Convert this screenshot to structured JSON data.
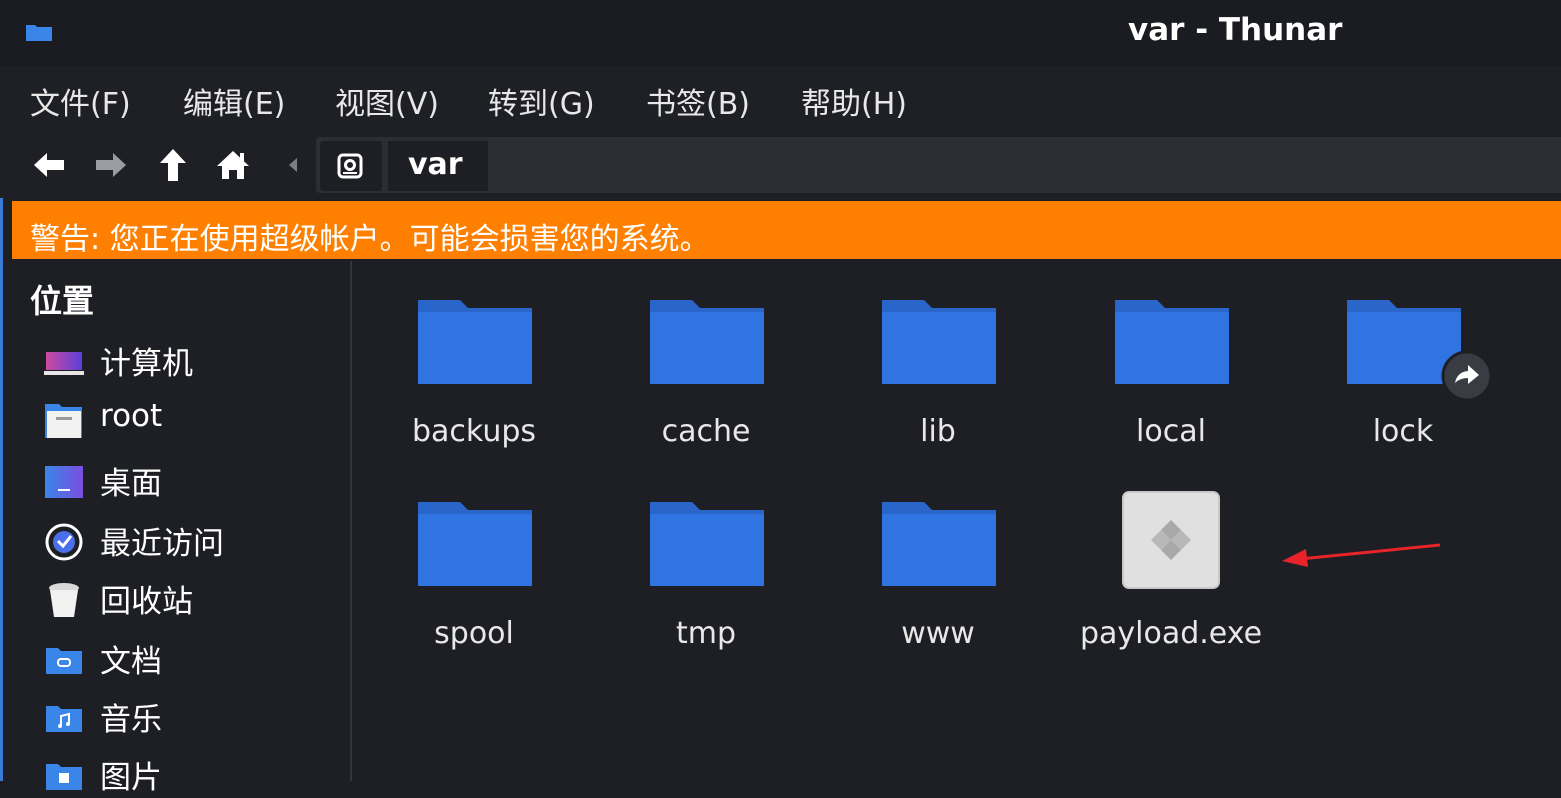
{
  "window": {
    "title": "var - Thunar",
    "icon": "folder-icon"
  },
  "menu": [
    {
      "label": "文件(F)"
    },
    {
      "label": "编辑(E)"
    },
    {
      "label": "视图(V)"
    },
    {
      "label": "转到(G)"
    },
    {
      "label": "书签(B)"
    },
    {
      "label": "帮助(H)"
    }
  ],
  "toolbar": {
    "buttons": [
      "back-arrow-icon",
      "forward-arrow-icon",
      "up-arrow-icon",
      "home-icon",
      "path-left-icon"
    ],
    "path": {
      "drive_icon": "drive-icon",
      "current": "var"
    }
  },
  "warning": {
    "text": "警告: 您正在使用超级帐户。可能会损害您的系统。",
    "color": "#ff8000"
  },
  "sidebar": {
    "title": "位置",
    "items": [
      {
        "label": "计算机",
        "icon": "computer-icon"
      },
      {
        "label": "root",
        "icon": "home-folder-icon"
      },
      {
        "label": "桌面",
        "icon": "desktop-icon"
      },
      {
        "label": "最近访问",
        "icon": "recent-clock-icon"
      },
      {
        "label": "回收站",
        "icon": "trash-icon"
      },
      {
        "label": "文档",
        "icon": "documents-folder-icon"
      },
      {
        "label": "音乐",
        "icon": "music-folder-icon"
      },
      {
        "label": "图片",
        "icon": "pictures-folder-icon"
      }
    ]
  },
  "files": [
    {
      "name": "backups",
      "type": "folder"
    },
    {
      "name": "cache",
      "type": "folder"
    },
    {
      "name": "lib",
      "type": "folder"
    },
    {
      "name": "local",
      "type": "folder"
    },
    {
      "name": "lock",
      "type": "folder-symlink"
    },
    {
      "name": "spool",
      "type": "folder"
    },
    {
      "name": "tmp",
      "type": "folder"
    },
    {
      "name": "www",
      "type": "folder"
    },
    {
      "name": "payload.exe",
      "type": "executable"
    }
  ],
  "colors": {
    "folder": "#2f74e0",
    "folder_tab": "#2a66c9",
    "annotation_arrow": "#e8232a"
  }
}
